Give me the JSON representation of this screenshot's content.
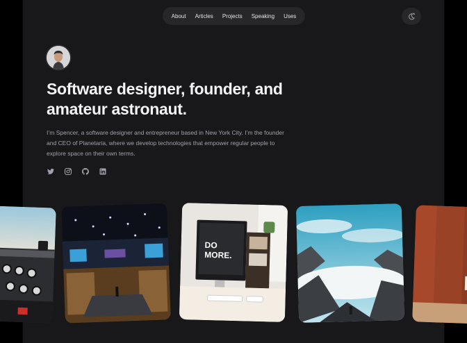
{
  "nav": {
    "items": [
      "About",
      "Articles",
      "Projects",
      "Speaking",
      "Uses"
    ]
  },
  "theme_toggle": {
    "icon": "sun-moon-icon"
  },
  "hero": {
    "headline_line1": "Software designer, founder, and",
    "headline_line2": "amateur astronaut.",
    "bio": "I’m Spencer, a software designer and entrepreneur based in New York City. I’m the founder and CEO of Planetaria, where we develop technologies that empower regular people to explore space on their own terms."
  },
  "socials": [
    "twitter-icon",
    "instagram-icon",
    "github-icon",
    "linkedin-icon"
  ],
  "photos": [
    {
      "name": "airplane-cockpit-photo",
      "logo_text": ""
    },
    {
      "name": "conference-stage-photo",
      "logo_text": ""
    },
    {
      "name": "desk-setup-photo",
      "logo_line1": "DO",
      "logo_line2": "MORE."
    },
    {
      "name": "mountain-hiker-photo",
      "logo_text": ""
    },
    {
      "name": "desert-rock-photo",
      "logo_text": ""
    }
  ],
  "colors": {
    "background": "#000000",
    "panel": "#18181b",
    "text": "#f4f4f5",
    "muted": "#a1a1aa"
  }
}
